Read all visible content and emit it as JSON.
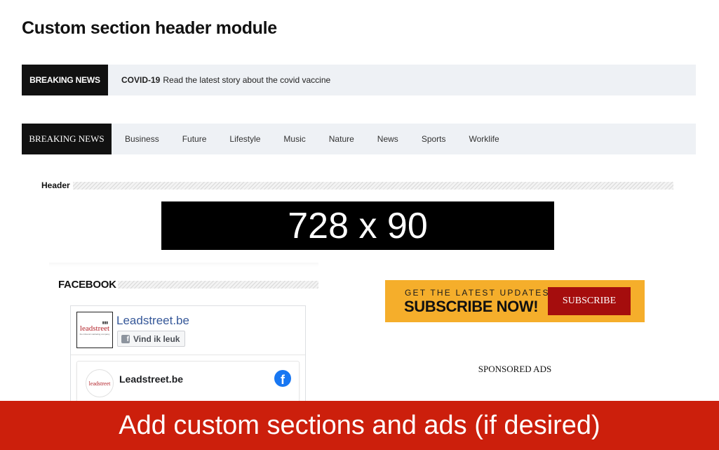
{
  "page": {
    "title": "Custom section header module"
  },
  "ticker": {
    "label": "BREAKING NEWS",
    "story_tag": "COVID-19",
    "story_text": "Read the latest story about the covid vaccine"
  },
  "nav": {
    "label": "BREAKING NEWS",
    "items": [
      "Business",
      "Future",
      "Lifestyle",
      "Music",
      "Nature",
      "News",
      "Sports",
      "Worklife"
    ]
  },
  "header_section": {
    "title": "Header"
  },
  "banner": {
    "text": "728 x 90"
  },
  "facebook_section": {
    "title": "FACEBOOK",
    "page_name": "Leadstreet.be",
    "like_label": "Vind ik leuk",
    "logo_brand": "leadstreet",
    "logo_tag": "the inbound marketing company",
    "card_name": "Leadstreet.be",
    "card_logo": "leadstreet"
  },
  "subscribe_ad": {
    "small_text": "GET THE LATEST UPDATES",
    "big_text": "SUBSCRIBE NOW!",
    "button_label": "SUBSCRIBE",
    "colors": {
      "background": "#f5ae2b",
      "button": "#a50d0d"
    }
  },
  "sponsored": {
    "label": "SPONSORED ADS"
  },
  "caption": {
    "text": "Add custom sections and ads (if desired)",
    "color": "#cc1f0c"
  },
  "icons": {
    "facebook": "facebook-icon",
    "like": "facebook-square-icon"
  }
}
